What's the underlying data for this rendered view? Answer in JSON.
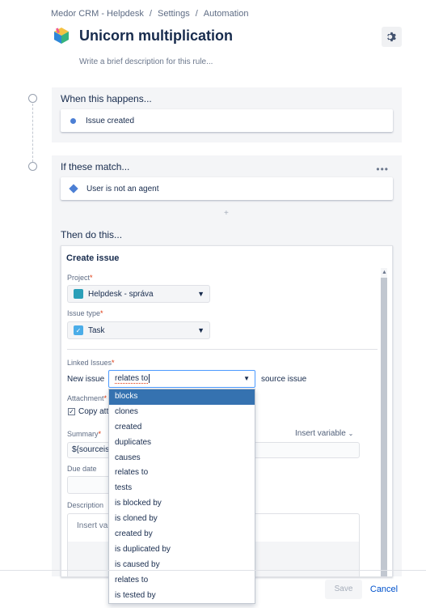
{
  "breadcrumbs": [
    "Medor CRM - Helpdesk",
    "Settings",
    "Automation"
  ],
  "rule": {
    "title": "Unicorn multiplication",
    "description_placeholder": "Write a brief description for this rule..."
  },
  "trigger": {
    "heading": "When this happens...",
    "item": "Issue created"
  },
  "condition": {
    "heading": "If these match...",
    "item": "User is not an agent",
    "more_label": "•••"
  },
  "add_symbol": "+",
  "action": {
    "heading": "Then do this...",
    "form_title": "Create issue",
    "project_label": "Project",
    "project_value": "Helpdesk - správa",
    "issue_type_label": "Issue type",
    "issue_type_value": "Task",
    "linked_issues_label": "Linked Issues",
    "new_issue_text": "New issue",
    "link_type_value": "relates to",
    "source_issue_text": "source issue",
    "attachment_label": "Attachment",
    "copy_attachments_text": "Copy att",
    "summary_label": "Summary",
    "insert_variable_label": "Insert variable",
    "summary_value": "${sourceiss",
    "due_date_label": "Due date",
    "description_label": "Description",
    "description_placeholder": "Insert var",
    "required_marker": "*"
  },
  "link_options": [
    "blocks",
    "clones",
    "created",
    "duplicates",
    "causes",
    "relates to",
    "tests",
    "is blocked by",
    "is cloned by",
    "created by",
    "is duplicated by",
    "is caused by",
    "relates to",
    "is tested by"
  ],
  "selected_option_index": 0,
  "footer": {
    "save_label": "Save",
    "cancel_label": "Cancel"
  },
  "colors": {
    "accent": "#0052cc",
    "selected": "#3572b0",
    "required": "#de350b",
    "panel": "#f4f5f7"
  }
}
